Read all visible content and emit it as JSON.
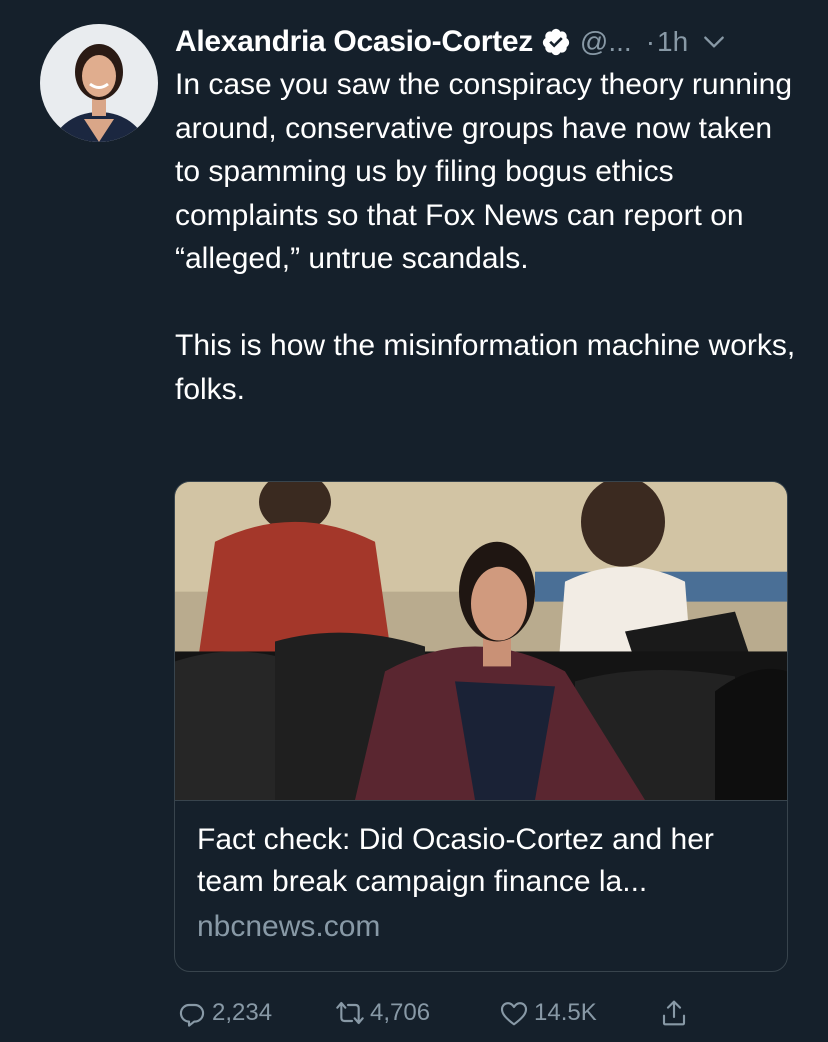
{
  "tweet": {
    "author_name": "Alexandria Ocasio-Cortez",
    "handle": "@...",
    "separator": "·",
    "time": "1h",
    "text": "In case you saw the conspiracy theory running around, conservative groups have now taken to spamming us by filing bogus ethics complaints so that Fox News can report on “alleged,” untrue scandals.\n\nThis is how the misinformation machine works, folks.",
    "icons": {
      "verified": "verified-badge-icon",
      "caret": "chevron-down-icon"
    }
  },
  "card": {
    "title": "Fact check: Did Ocasio-Cortez and her team break campaign finance la...",
    "domain": "nbcnews.com"
  },
  "actions": {
    "reply_count": "2,234",
    "retweet_count": "4,706",
    "like_count": "14.5K",
    "icons": [
      "reply-icon",
      "retweet-icon",
      "like-icon",
      "share-icon"
    ]
  },
  "colors": {
    "background": "#15202b",
    "text": "#ffffff",
    "secondary_text": "#8899a6",
    "border": "#38444d"
  }
}
